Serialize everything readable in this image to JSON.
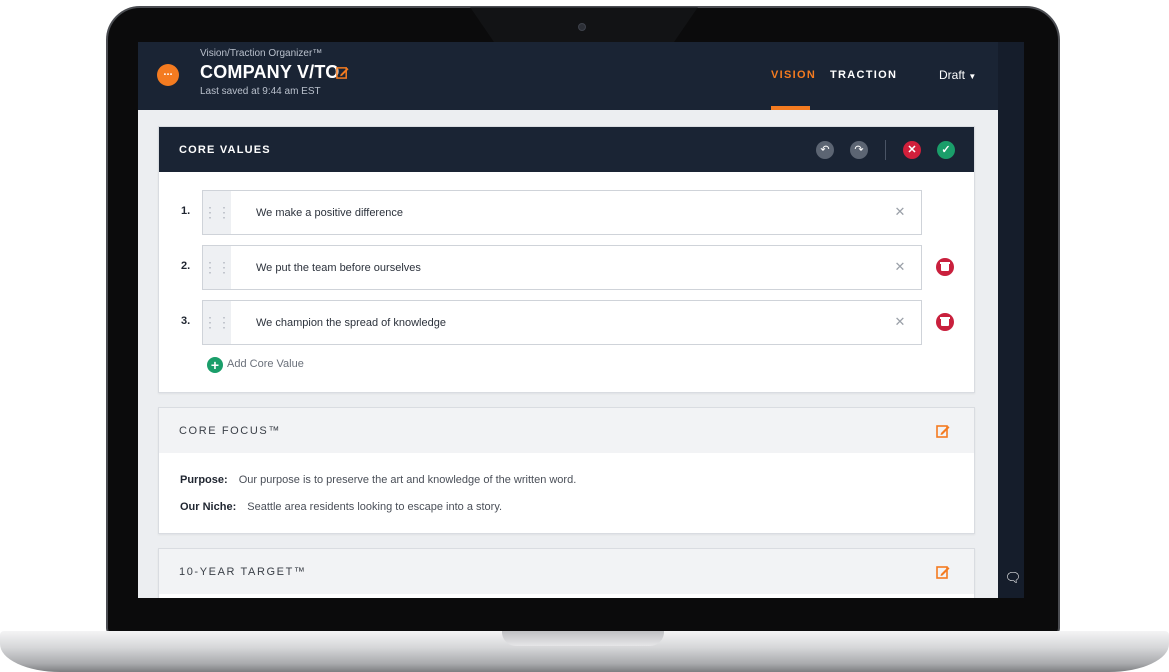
{
  "app": {
    "supertitle": "Vision/Traction Organizer™",
    "title": "COMPANY V/TO",
    "last_saved": "Last saved at 9:44 am EST",
    "menu_label": "...",
    "tabs": [
      {
        "label": "VISION",
        "active": true
      },
      {
        "label": "TRACTION",
        "active": false
      }
    ],
    "status_select": "Draft",
    "accent_color": "#f47b20",
    "header_color": "#1a2434"
  },
  "core_values": {
    "title": "CORE VALUES",
    "actions": {
      "undo_icon": "undo-icon",
      "redo_icon": "redo-icon",
      "cancel_icon": "close-icon",
      "confirm_icon": "check-icon"
    },
    "items": [
      {
        "number": "1.",
        "text": "We make a positive difference",
        "deletable": false
      },
      {
        "number": "2.",
        "text": "We put the team before ourselves",
        "deletable": true
      },
      {
        "number": "3.",
        "text": "We champion the spread of knowledge",
        "deletable": true
      }
    ],
    "add_label": "Add Core Value"
  },
  "core_focus": {
    "title": "CORE FOCUS™",
    "purpose_label": "Purpose:",
    "purpose_text": "Our purpose is to preserve the art and knowledge of the written word.",
    "niche_label": "Our Niche:",
    "niche_text": "Seattle area residents looking to escape into a story."
  },
  "ten_year_target": {
    "title": "10-YEAR TARGET™"
  }
}
